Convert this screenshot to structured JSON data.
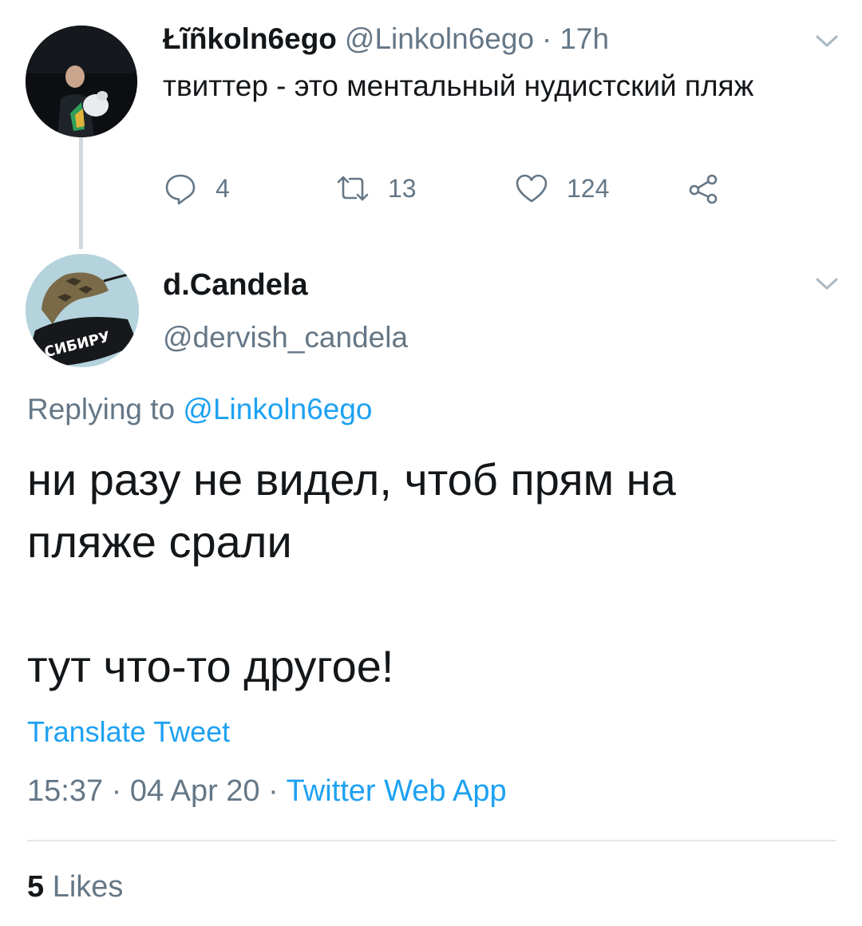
{
  "parent_tweet": {
    "display_name": "Łĩñkoln6ego",
    "handle": "@Linkoln6ego",
    "time_ago": "17h",
    "text": "твиттер - это ментальный нудистский пляж",
    "stats": {
      "replies": "4",
      "retweets": "13",
      "likes": "124"
    }
  },
  "reply_tweet": {
    "display_name": "d.Candela",
    "handle": "@dervish_candela",
    "replying_to_label": "Replying to",
    "replying_to_handle": "@Linkoln6ego",
    "text": "ни разу не видел, чтоб прям на\nпляже срали\n\nтут что-то другое!",
    "translate_label": "Translate Tweet",
    "time": "15:37",
    "date": "04 Apr 20",
    "source": "Twitter Web App",
    "likes_count": "5",
    "likes_label": "Likes",
    "avatar_text": "СИБИРУ"
  },
  "icons": {
    "reply": "speech-bubble-icon",
    "retweet": "retweet-icon",
    "like": "heart-icon",
    "share": "share-icon",
    "more": "chevron-down-icon"
  },
  "colors": {
    "accent": "#1da1f2",
    "muted": "#657786",
    "text": "#14171a",
    "divider": "#e1e8ed"
  }
}
